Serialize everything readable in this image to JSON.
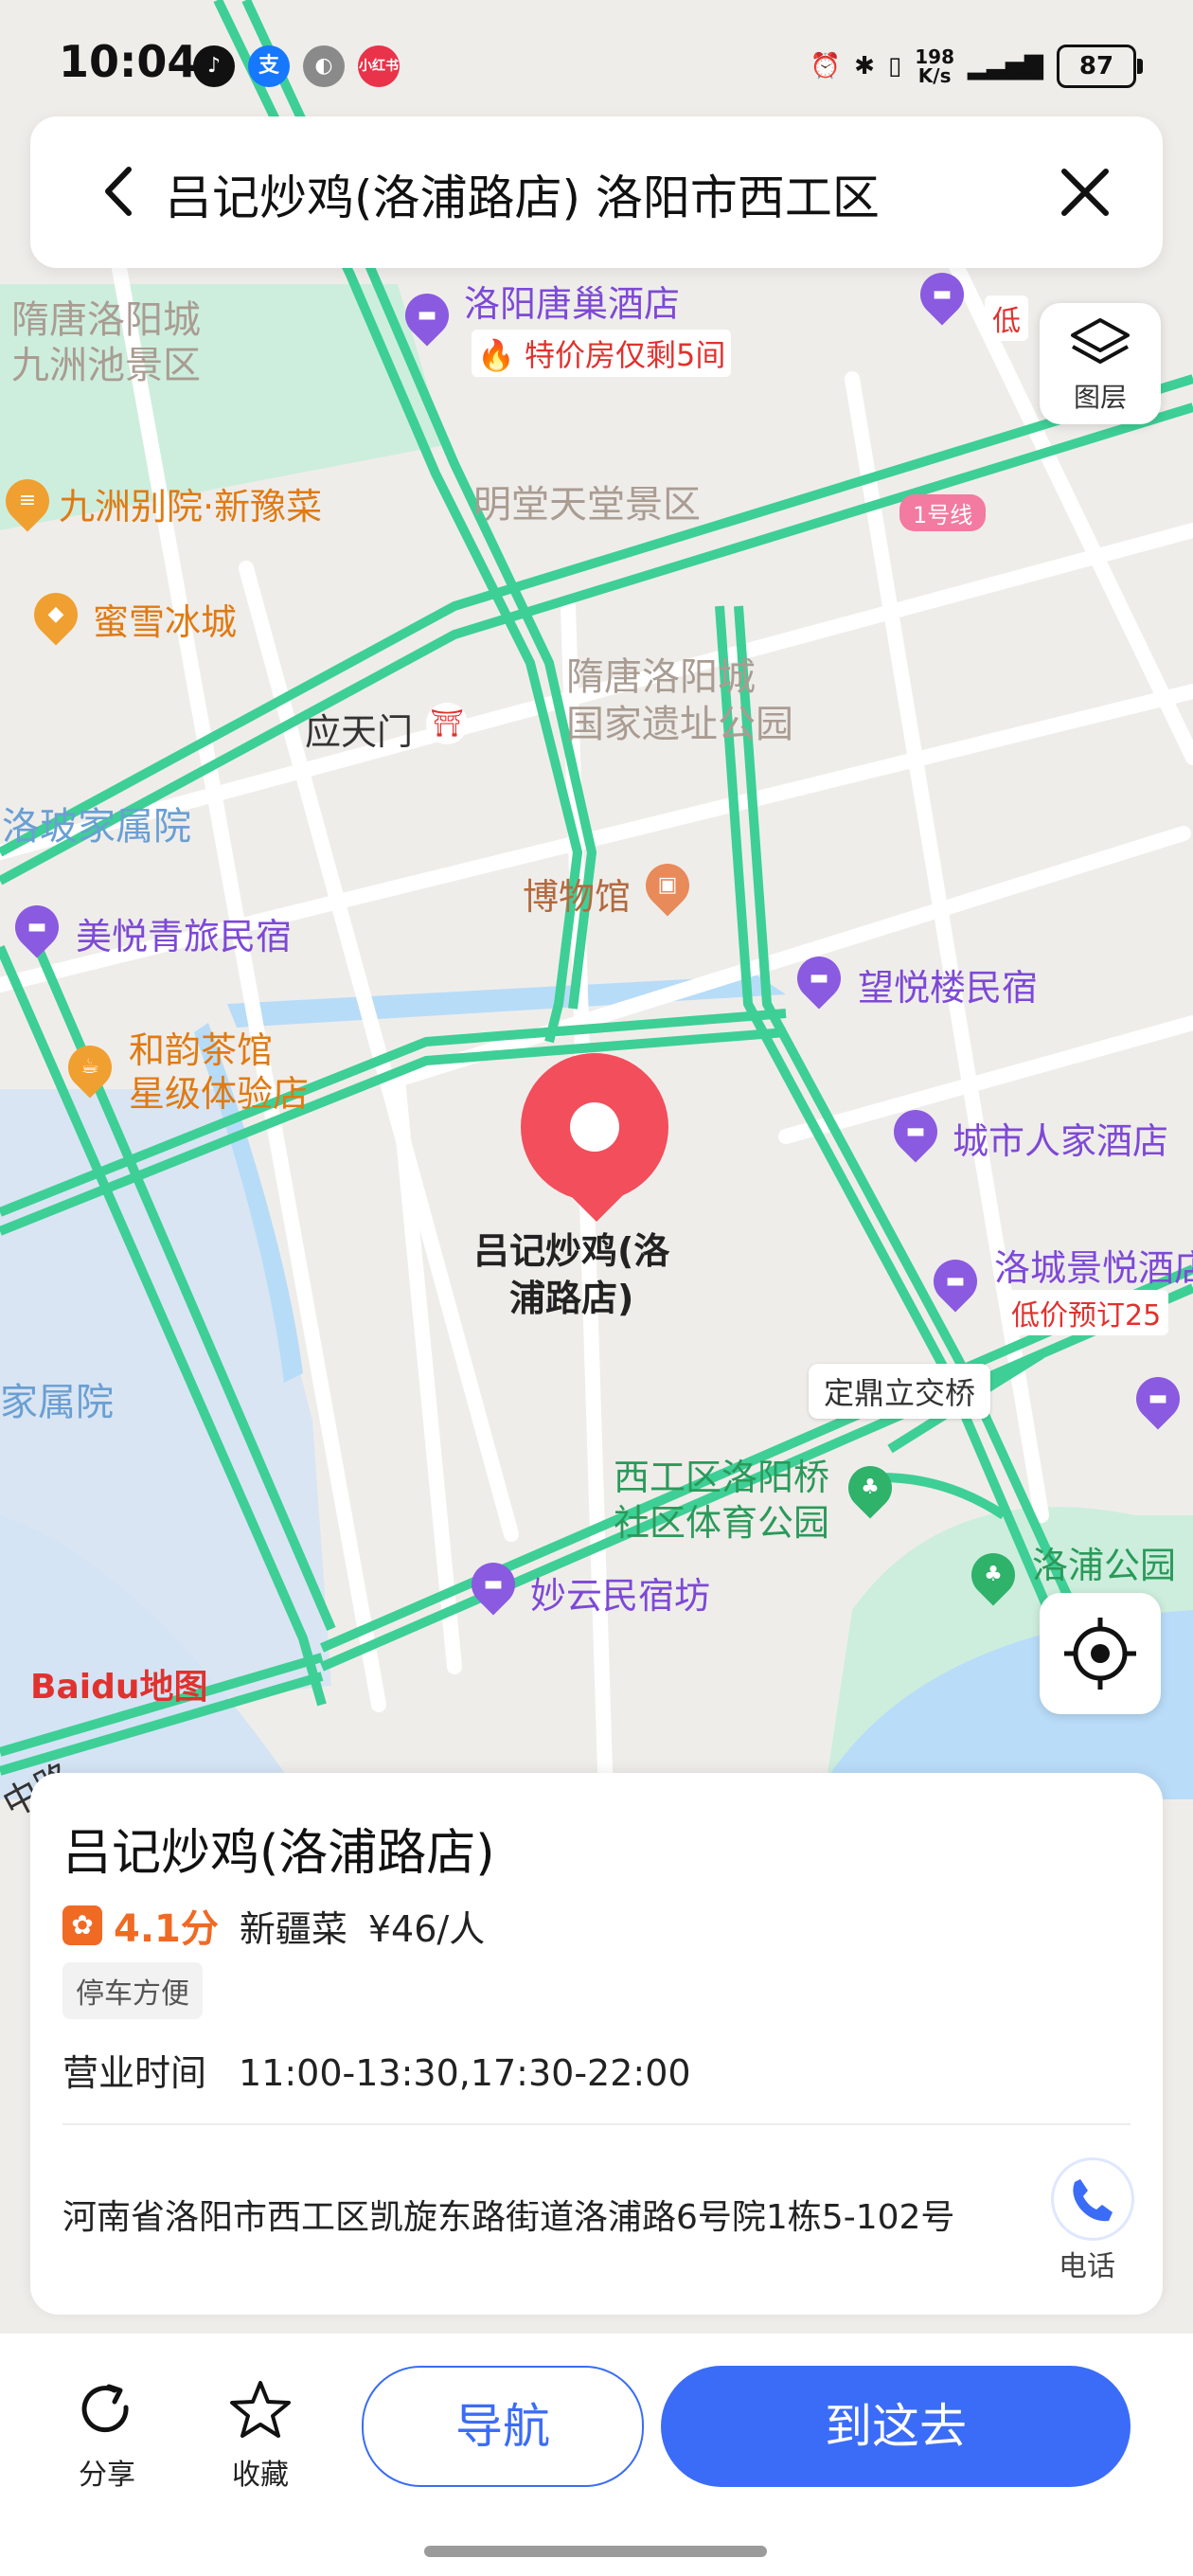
{
  "status_bar": {
    "time": "10:04",
    "net_speed_value": "198",
    "net_speed_unit": "K/s",
    "battery": "87"
  },
  "search": {
    "query": "吕记炒鸡(洛浦路店) 洛阳市西工区"
  },
  "layers_button": {
    "label": "图层"
  },
  "map": {
    "brand": "Baidu地图",
    "line_badge": "1号线",
    "labels": {
      "area_sui_tang": "隋唐洛阳城\n九洲池景区",
      "mingtang": "明堂天堂景区",
      "heritage_park": "隋唐洛阳城\n国家遗址公园",
      "luopo": "洛玻家属院",
      "jiashuyuan": "家属院",
      "yingtianmen": "应天门",
      "tangchao_hotel": "洛阳唐巢酒店",
      "tangchao_promo": "特价房仅剩5间",
      "jiuzhou": "九洲别院·新豫菜",
      "mixue": "蜜雪冰城",
      "bowuguan": "博物馆",
      "meiyue": "美悦青旅民宿",
      "wangyue": "望悦楼民宿",
      "heyun": "和韵茶馆\n星级体验店",
      "chengshi": "城市人家酒店",
      "luocheng": "洛城景悦酒店",
      "luocheng_promo": "低价预订25",
      "dingding": "定鼎立交桥",
      "xigong_park": "西工区洛阳桥\n社区体育公园",
      "miaoyun": "妙云民宿坊",
      "luopu_park": "洛浦公园",
      "main_pin": "吕记炒鸡(洛\n浦路店)",
      "top_right_promo": "低",
      "zhong_lu": "中路"
    }
  },
  "place_card": {
    "name": "吕记炒鸡(洛浦路店)",
    "rating": "4.1分",
    "cuisine": "新疆菜",
    "price": "¥46/人",
    "tag": "停车方便",
    "hours_label": "营业时间",
    "hours_value": "11:00-13:30,17:30-22:00",
    "address": "河南省洛阳市西工区凯旋东路街道洛浦路6号院1栋5-102号",
    "phone_label": "电话"
  },
  "bottom_bar": {
    "share": "分享",
    "favorite": "收藏",
    "navigate": "导航",
    "go_here": "到这去"
  },
  "colors": {
    "road_green": "#3ecf96",
    "accent_blue": "#3b6cf7",
    "pin_red": "#f24e5c",
    "poi_purple": "#8a5ae0",
    "poi_orange": "#f0a030",
    "water": "#b7dcf8"
  }
}
